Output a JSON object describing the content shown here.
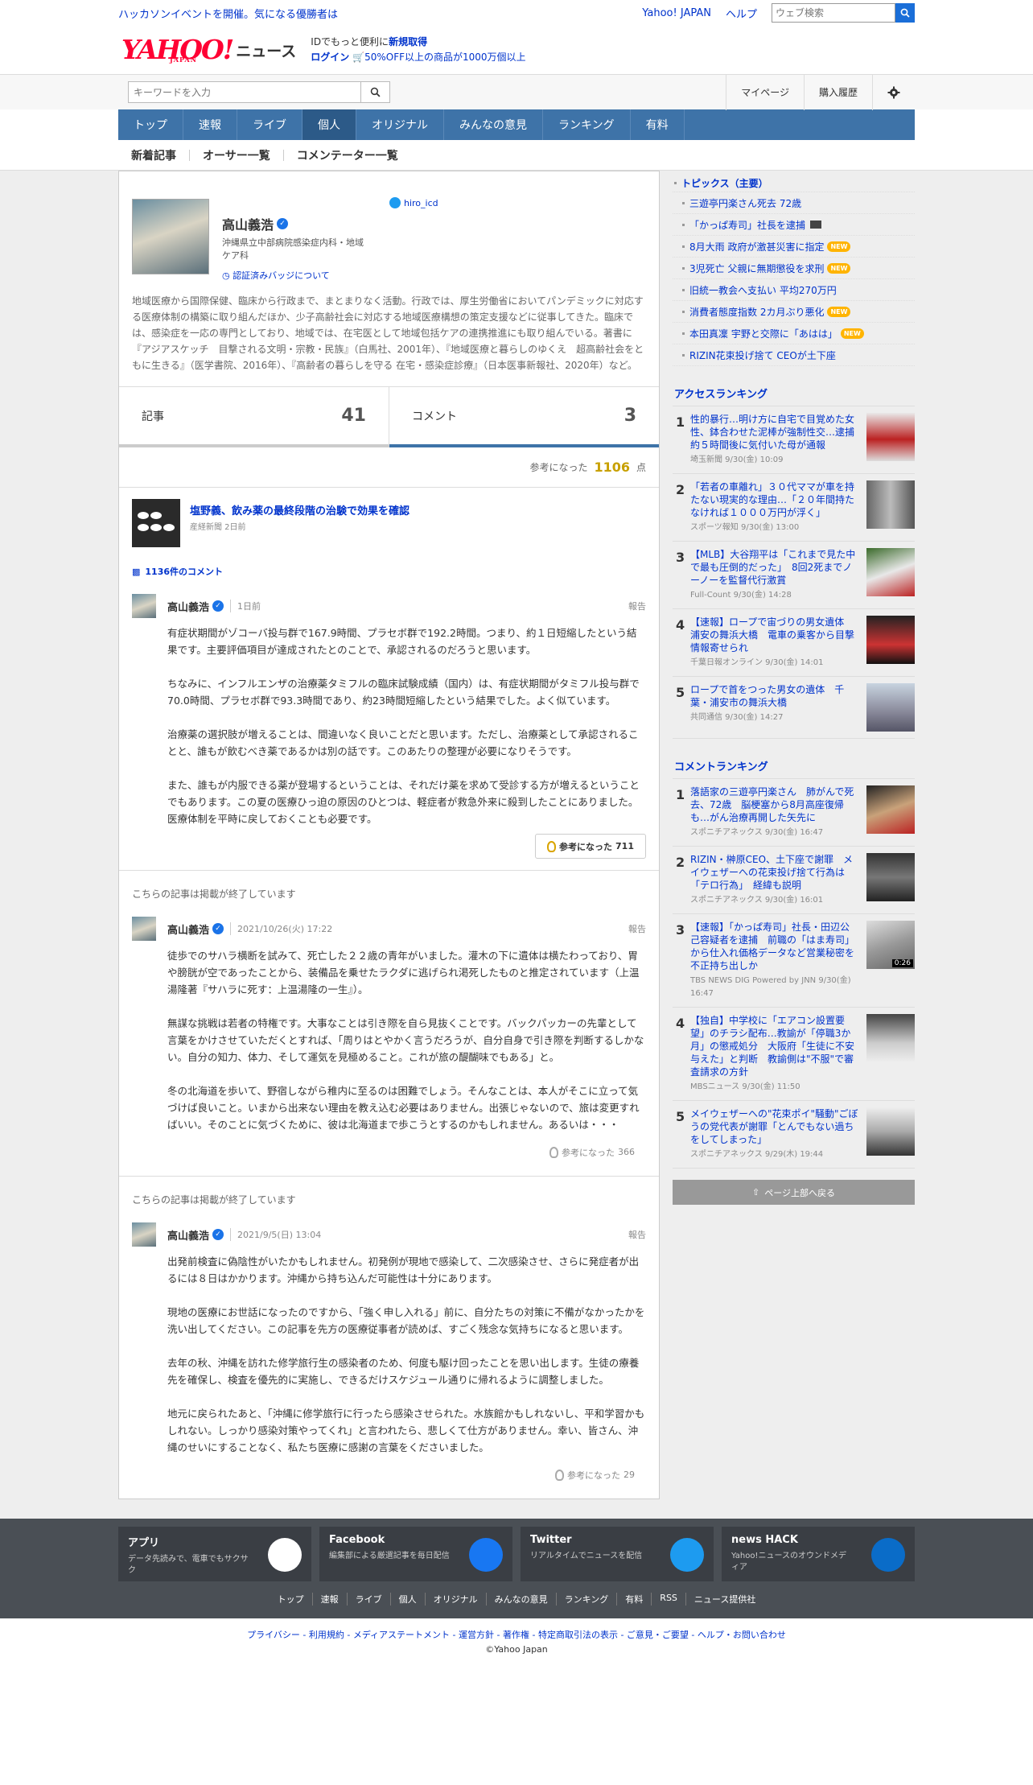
{
  "util": {
    "promo": "ハッカソンイベントを開催。気になる優勝者は",
    "yahoo_japan": "Yahoo! JAPAN",
    "help": "ヘルプ",
    "web_search_placeholder": "ウェブ検索"
  },
  "header": {
    "logo_text": "YAHOO!",
    "logo_sub": "JAPAN",
    "logo_news": "ニュース",
    "id_line1_pre": "IDでもっと便利に",
    "id_line1_link": "新規取得",
    "login": "ログイン",
    "promo2": "50%OFF以上の商品が1000万個以上"
  },
  "search": {
    "placeholder": "キーワードを入力",
    "mypage": "マイページ",
    "history": "購入履歴"
  },
  "nav": {
    "items": [
      "トップ",
      "速報",
      "ライブ",
      "個人",
      "オリジナル",
      "みんなの意見",
      "ランキング",
      "有料"
    ]
  },
  "subnav": {
    "items": [
      "新着記事",
      "オーサー一覧",
      "コメンテーター一覧"
    ]
  },
  "profile": {
    "name": "高山義浩",
    "affiliation": "沖縄県立中部病院感染症内科・地域ケア科",
    "badge_link": "認証済みバッジについて",
    "twitter": "hiro_icd",
    "bio": "地域医療から国際保健、臨床から行政まで、まとまりなく活動。行政では、厚生労働省においてパンデミックに対応する医療体制の構築に取り組んだほか、少子高齢社会に対応する地域医療構想の策定支援などに従事してきた。臨床では、感染症を一応の専門としており、地域では、在宅医として地域包括ケアの連携推進にも取り組んでいる。著書に『アジアスケッチ　目撃される文明・宗教・民族』（白馬社、2001年）、『地域医療と暮らしのゆくえ　超高齢社会をともに生きる』（医学書院、2016年）、『高齢者の暮らしを守る 在宅・感染症診療』（日本医事新報社、2020年）など。"
  },
  "tabs": {
    "articles_label": "記事",
    "articles_count": "41",
    "comments_label": "コメント",
    "comments_count": "3"
  },
  "reference": {
    "label": "参考になった",
    "value": "1106",
    "unit": "点"
  },
  "article": {
    "title": "塩野義、飲み薬の最終段階の治験で効果を確認",
    "source": "産経新聞 2日前",
    "comment_count": "1136件のコメント"
  },
  "comments": [
    {
      "name": "高山義浩",
      "date": "1日前",
      "report": "報告",
      "paragraphs": [
        "有症状期間がゾコーバ投与群で167.9時間、プラセボ群で192.2時間。つまり、約１日短縮したという結果です。主要評価項目が達成されたとのことで、承認されるのだろうと思います。",
        "ちなみに、インフルエンザの治療薬タミフルの臨床試験成績（国内）は、有症状期間がタミフル投与群で70.0時間、プラセボ群で93.3時間であり、約23時間短縮したという結果でした。よく似ています。",
        "治療薬の選択肢が増えることは、間違いなく良いことだと思います。ただし、治療薬として承認されることと、誰もが飲むべき薬であるかは別の話です。このあたりの整理が必要になりそうです。",
        "また、誰もが内服できる薬が登場するということは、それだけ薬を求めて受診する方が増えるということでもあります。この夏の医療ひっ迫の原因のひとつは、軽症者が救急外来に殺到したことにありました。医療体制を平時に戻しておくことも必要です。"
      ],
      "helpful_label": "参考になった",
      "helpful_count": "711"
    },
    {
      "ended": "こちらの記事は掲載が終了しています",
      "name": "高山義浩",
      "date": "2021/10/26(火) 17:22",
      "report": "報告",
      "paragraphs": [
        "徒歩でのサハラ横断を試みて、死亡した２２歳の青年がいました。灌木の下に遺体は横たわっており、胃や膀胱が空であったことから、装備品を乗せたラクダに逃げられ渇死したものと推定されています（上温湯隆著『サハラに死す：上温湯隆の一生』）。",
        "無謀な挑戦は若者の特権です。大事なことは引き際を自ら見抜くことです。バックパッカーの先輩として言葉をかけさせていただくとすれば、「周りはとやかく言うだろうが、自分自身で引き際を判断するしかない。自分の知力、体力、そして運気を見極めること。これが旅の醍醐味でもある」と。",
        "冬の北海道を歩いて、野宿しながら稚内に至るのは困難でしょう。そんなことは、本人がそこに立って気づけば良いこと。いまから出来ない理由を教え込む必要はありません。出張じゃないので、旅は変更すればいい。そのことに気づくために、彼は北海道まで歩こうとするのかもしれません。あるいは・・・"
      ],
      "helpful_label": "参考になった",
      "helpful_count": "366"
    },
    {
      "ended": "こちらの記事は掲載が終了しています",
      "name": "高山義浩",
      "date": "2021/9/5(日) 13:04",
      "report": "報告",
      "paragraphs": [
        "出発前検査に偽陰性がいたかもしれません。初発例が現地で感染して、二次感染させ、さらに発症者が出るには８日はかかります。沖縄から持ち込んだ可能性は十分にあります。",
        "現地の医療にお世話になったのですから、「強く申し入れる」前に、自分たちの対策に不備がなかったかを洗い出してください。この記事を先方の医療従事者が読めば、すごく残念な気持ちになると思います。",
        "去年の秋、沖縄を訪れた修学旅行生の感染者のため、何度も駆け回ったことを思い出します。生徒の療養先を確保し、検査を優先的に実施し、できるだけスケジュール通りに帰れるように調整しました。",
        "地元に戻られたあと、「沖縄に修学旅行に行ったら感染させられた。水族館かもしれないし、平和学習かもしれない。しっかり感染対策やってくれ」と言われたら、悲しくて仕方がありません。幸い、皆さん、沖縄のせいにすることなく、私たち医療に感謝の言葉をくださいました。"
      ],
      "helpful_label": "参考になった",
      "helpful_count": "29"
    }
  ],
  "topics": {
    "heading": "トピックス（主要）",
    "items": [
      {
        "text": "三遊亭円楽さん死去 72歳",
        "new": ""
      },
      {
        "text": "「かっぱ寿司」社長を逮捕",
        "new": "",
        "video": true
      },
      {
        "text": "8月大雨 政府が激甚災害に指定",
        "new": "NEW"
      },
      {
        "text": "3児死亡 父親に無期懲役を求刑",
        "new": "NEW"
      },
      {
        "text": "旧統一教会へ支払い 平均270万円",
        "new": ""
      },
      {
        "text": "消費者態度指数 2カ月ぶり悪化",
        "new": "NEW"
      },
      {
        "text": "本田真凜 宇野と交際に「あはは」",
        "new": "NEW"
      },
      {
        "text": "RIZIN花束投げ捨て CEOが土下座",
        "new": ""
      }
    ]
  },
  "access_ranking": {
    "heading": "アクセスランキング",
    "items": [
      {
        "no": "1",
        "title": "性的暴行…明け方に自宅で目覚めた女性、鉢合わせた泥棒が強制性交…逮捕　約５時間後に気付いた母が通報",
        "meta": "埼玉新聞 9/30(金) 10:09"
      },
      {
        "no": "2",
        "title": "「若者の車離れ」３０代ママが車を持たない現実的な理由…「２０年間持たなければ１０００万円が浮く」",
        "meta": "スポーツ報知 9/30(金) 13:00"
      },
      {
        "no": "3",
        "title": "【MLB】大谷翔平は「これまで見た中で最も圧倒的だった」　8回2死までノーノーを監督代行激賞",
        "meta": "Full-Count 9/30(金) 14:28"
      },
      {
        "no": "4",
        "title": "【速報】ロープで宙づりの男女遺体　浦安の舞浜大橋　電車の乗客から目撃情報寄せられ",
        "meta": "千葉日報オンライン 9/30(金) 14:01"
      },
      {
        "no": "5",
        "title": "ロープで首をつった男女の遺体　千葉・浦安市の舞浜大橋",
        "meta": "共同通信 9/30(金) 14:27"
      }
    ]
  },
  "comment_ranking": {
    "heading": "コメントランキング",
    "items": [
      {
        "no": "1",
        "title": "落語家の三遊亭円楽さん　肺がんで死去、72歳　脳梗塞から8月高座復帰も…がん治療再開した矢先に",
        "meta": "スポニチアネックス 9/30(金) 16:47"
      },
      {
        "no": "2",
        "title": "RIZIN・榊原CEO、土下座で謝罪　メイウェザーへの花束投げ捨て行為は「テロ行為」　経緯も説明",
        "meta": "スポニチアネックス 9/30(金) 16:01"
      },
      {
        "no": "3",
        "title": "【速報】「かっぱ寿司」社長・田辺公己容疑者を逮捕　前職の「はま寿司」から仕入れ価格データなど営業秘密を不正持ち出しか",
        "meta": "TBS NEWS DIG Powered by JNN 9/30(金) 16:47",
        "video_time": "0:26"
      },
      {
        "no": "4",
        "title": "【独自】中学校に「エアコン設置要望」のチラシ配布…教諭が「停職3か月」の懲戒処分　大阪府「生徒に不安与えた」と判断　教諭側は\"不服\"で審査請求の方針",
        "meta": "MBSニュース 9/30(金) 11:50"
      },
      {
        "no": "5",
        "title": "メイウェザーへの\"花束ポイ\"騒動\"ごぼうの党代表が謝罪「とんでもない過ちをしてしまった」",
        "meta": "スポニチアネックス 9/29(木) 19:44"
      }
    ]
  },
  "back_to_top": "ページ上部へ戻る",
  "footer": {
    "cards": [
      {
        "title": "アプリ",
        "desc": "データ先読みで、電車でもサクサク"
      },
      {
        "title": "Facebook",
        "desc": "編集部による厳選記事を毎日配信"
      },
      {
        "title": "Twitter",
        "desc": "リアルタイムでニュースを配信"
      },
      {
        "title": "news HACK",
        "desc": "Yahoo!ニュースのオウンドメディア"
      }
    ],
    "links": [
      "トップ",
      "速報",
      "ライブ",
      "個人",
      "オリジナル",
      "みんなの意見",
      "ランキング",
      "有料",
      "RSS",
      "ニュース提供社"
    ],
    "legal": "プライバシー - 利用規約 - メディアステートメント - 運営方針 - 著作権 - 特定商取引法の表示 - ご意見・ご要望 - ヘルプ・お問い合わせ",
    "copyright": "©Yahoo Japan"
  },
  "colors": {
    "nav": "#3e73a8",
    "link": "#0033cc",
    "logo": "#ff0033",
    "highlight": "#c8a000"
  }
}
